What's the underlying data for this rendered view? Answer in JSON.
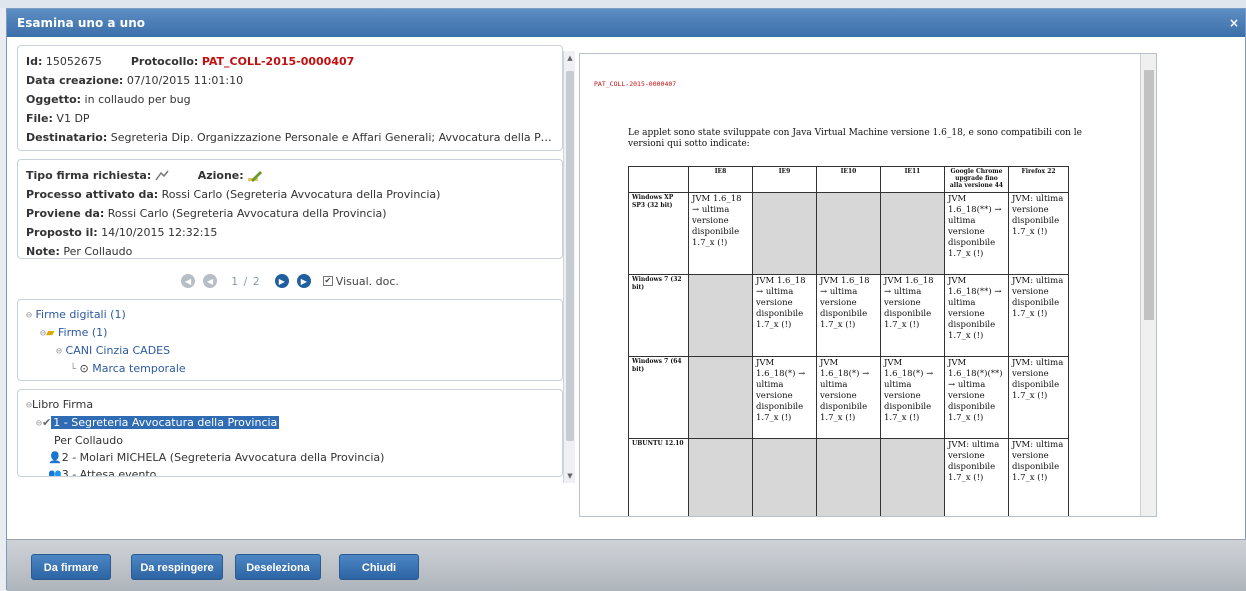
{
  "window": {
    "title": "Esamina uno a uno",
    "close": "×"
  },
  "details": {
    "id_label": "Id:",
    "id_value": "15052675",
    "protocollo_label": "Protocollo:",
    "protocollo_value": "PAT_COLL-2015-0000407",
    "data_label": "Data creazione:",
    "data_value": "07/10/2015 11:01:10",
    "oggetto_label": "Oggetto:",
    "oggetto_value": "in collaudo per bug",
    "file_label": "File:",
    "file_value": "V1 DP",
    "destinatario_label": "Destinatario:",
    "destinatario_value": "Segreteria Dip. Organizzazione Personale e Affari Generali; Avvocatura della Pr..."
  },
  "process": {
    "tipo_label": "Tipo firma richiesta:",
    "azione_label": "Azione:",
    "processo_label": "Processo attivato da:",
    "processo_value": "Rossi Carlo (Segreteria Avvocatura della Provincia)",
    "proviene_label": "Proviene da:",
    "proviene_value": "Rossi Carlo (Segreteria Avvocatura della Provincia)",
    "proposto_label": "Proposto il:",
    "proposto_value": "14/10/2015 12:32:15",
    "note_label": "Note:",
    "note_value": "Per Collaudo"
  },
  "pager": {
    "text": "1 / 2",
    "visual_doc": "Visual. doc."
  },
  "signatures": {
    "root": "Firme digitali (1)",
    "folder": "Firme (1)",
    "signer": "CANI Cinzia CADES",
    "timestamp": "Marca temporale"
  },
  "libro": {
    "root": "Libro Firma",
    "step1": "1 - Segreteria Avvocatura della Provincia",
    "step1_note": "Per Collaudo",
    "step2": "2 - Molari MICHELA (Segreteria Avvocatura della Provincia)",
    "step3": "3 - Attesa evento"
  },
  "document": {
    "header": "PAT_COLL-2015-0000407",
    "intro": "Le applet sono state sviluppate con Java Virtual Machine versione 1.6_18, e sono compatibili con le versioni qui sotto indicate:",
    "columns": [
      "",
      "IE8",
      "IE9",
      "IE10",
      "IE11",
      "Google Chrome upgrade fino alla versione 44",
      "Firefox 22"
    ],
    "rows": [
      {
        "label": "Windows XP SP3 (32 bit)",
        "cells": [
          "JVM 1.6_18 → ultima versione disponibile 1.7_x (!)",
          "",
          "",
          "",
          "JVM 1.6_18(**) → ultima versione disponibile 1.7_x (!)",
          "JVM: ultima versione disponibile 1.7_x (!)"
        ],
        "gray": [
          false,
          true,
          true,
          true,
          false,
          false
        ]
      },
      {
        "label": "Windows 7 (32 bit)",
        "cells": [
          "",
          "JVM 1.6_18 → ultima versione disponibile 1.7_x (!)",
          "JVM 1.6_18 → ultima versione disponibile 1.7_x (!)",
          "JVM 1.6_18 → ultima versione disponibile 1.7_x (!)",
          "JVM 1.6_18(**) → ultima versione disponibile 1.7_x (!)",
          "JVM: ultima versione disponibile 1.7_x (!)"
        ],
        "gray": [
          true,
          false,
          false,
          false,
          false,
          false
        ]
      },
      {
        "label": "Windows 7 (64 bit)",
        "cells": [
          "",
          "JVM 1.6_18(*) → ultima versione disponibile 1.7_x (!)",
          "JVM 1.6_18(*) → ultima versione disponibile 1.7_x (!)",
          "JVM 1.6_18(*) → ultima versione disponibile 1.7_x (!)",
          "JVM 1.6_18(*)(**) → ultima versione disponibile 1.7_x (!)",
          "JVM: ultima versione disponibile 1.7_x (!)"
        ],
        "gray": [
          true,
          false,
          false,
          false,
          false,
          false
        ]
      },
      {
        "label": "UBUNTU 12.10",
        "cells": [
          "",
          "",
          "",
          "",
          "JVM: ultima versione disponibile 1.7_x (!)",
          "JVM: ultima versione disponibile 1.7_x (!)"
        ],
        "gray": [
          true,
          true,
          true,
          true,
          false,
          false
        ]
      }
    ]
  },
  "buttons": {
    "firmare": "Da firmare",
    "respingere": "Da respingere",
    "deseleziona": "Deseleziona",
    "chiudi": "Chiudi"
  }
}
